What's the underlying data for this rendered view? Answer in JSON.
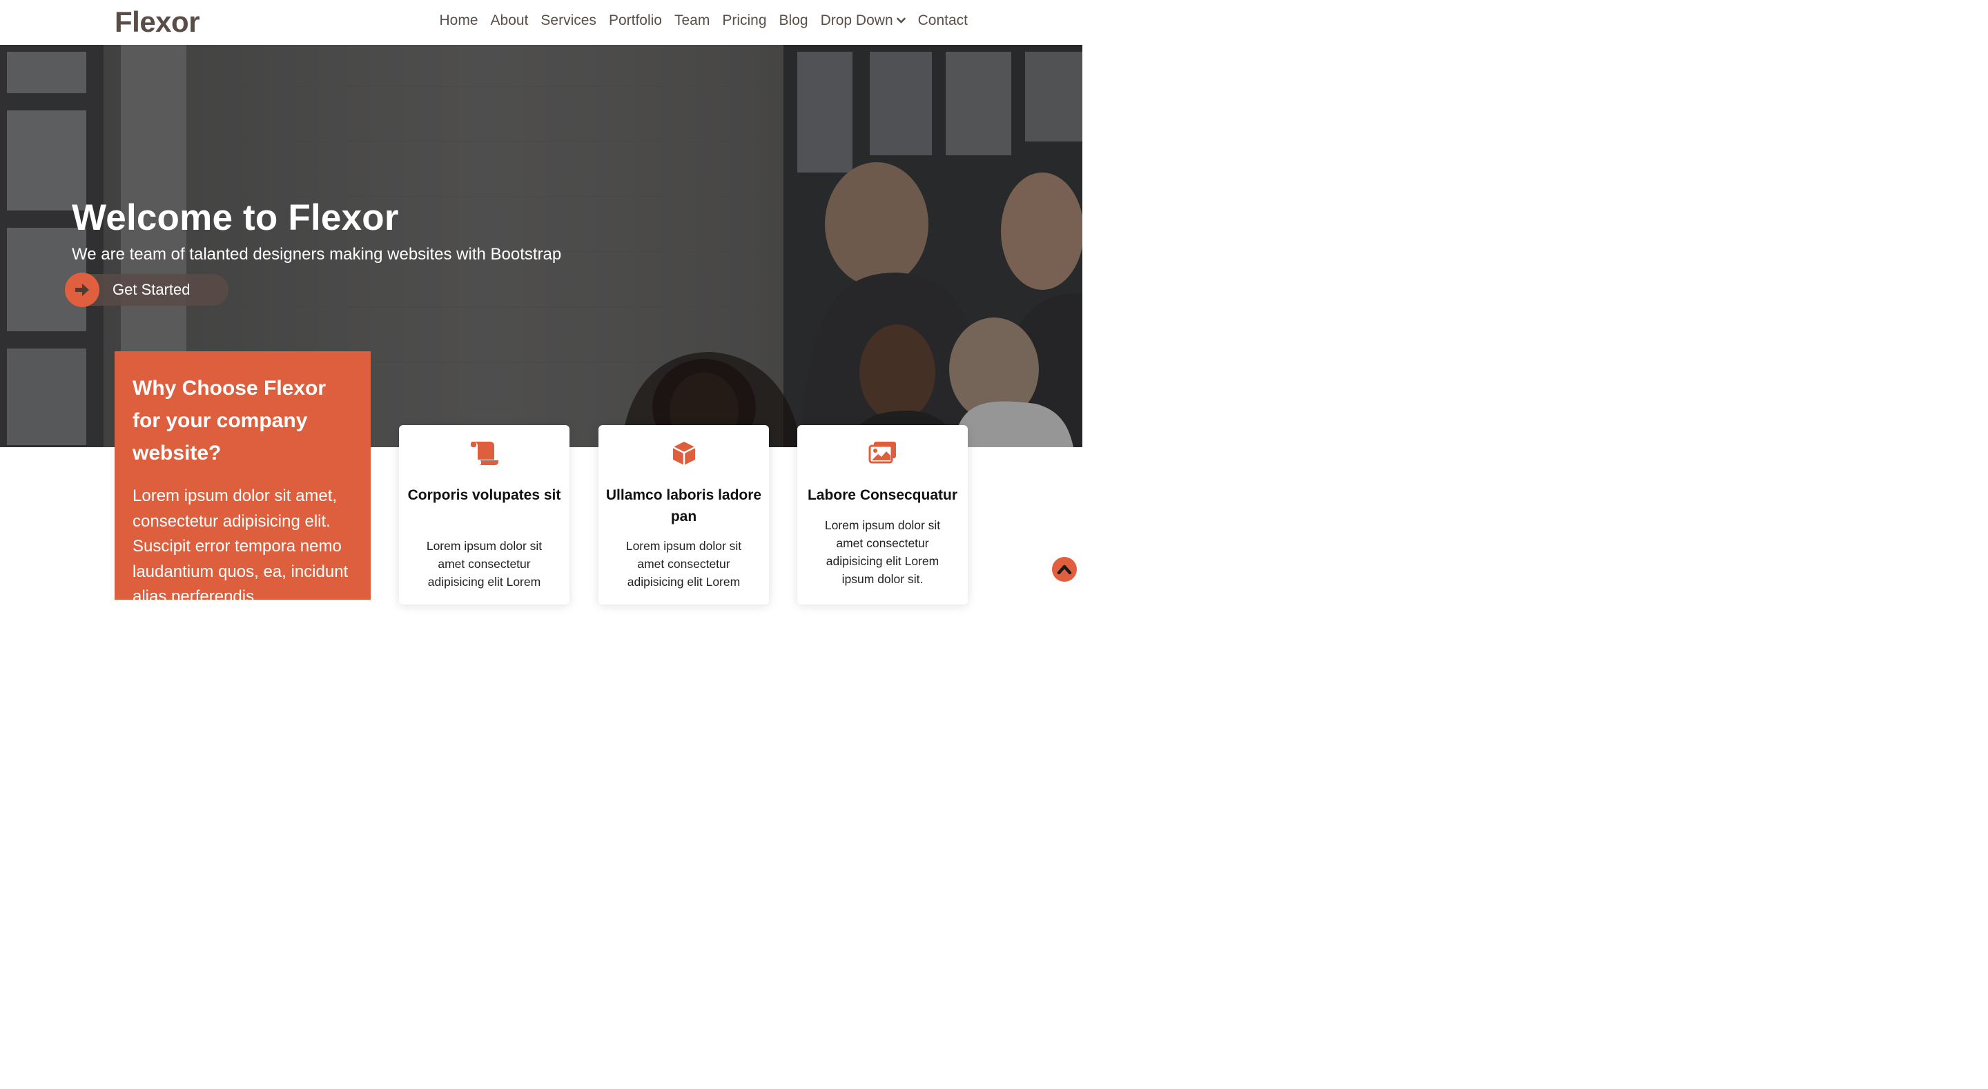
{
  "header": {
    "logo": "Flexor",
    "nav": [
      "Home",
      "About",
      "Services",
      "Portfolio",
      "Team",
      "Pricing",
      "Blog",
      "Drop Down",
      "Contact"
    ]
  },
  "hero": {
    "title": "Welcome to Flexor",
    "subtitle": "We are team of talanted designers making websites with Bootstrap",
    "cta_label": "Get Started"
  },
  "why": {
    "title": "Why Choose Flexor for your company website?",
    "text": "Lorem ipsum dolor sit amet, consectetur adipisicing elit. Suscipit error tempora nemo laudantium quos, ea, incidunt alias perferendis"
  },
  "cards": [
    {
      "icon": "scroll-icon",
      "title": "Corporis volupates sit",
      "text": "Lorem ipsum dolor sit amet consectetur adipisicing elit Lorem"
    },
    {
      "icon": "cube-icon",
      "title": "Ullamco laboris ladore pan",
      "text": "Lorem ipsum dolor sit amet consectetur adipisicing elit Lorem"
    },
    {
      "icon": "images-icon",
      "title": "Labore Consecquatur",
      "text": "Lorem ipsum dolor sit amet consectetur adipisicing elit Lorem ipsum dolor sit."
    }
  ],
  "colors": {
    "accent": "#e05f3e",
    "brand": "#5a4d47"
  }
}
